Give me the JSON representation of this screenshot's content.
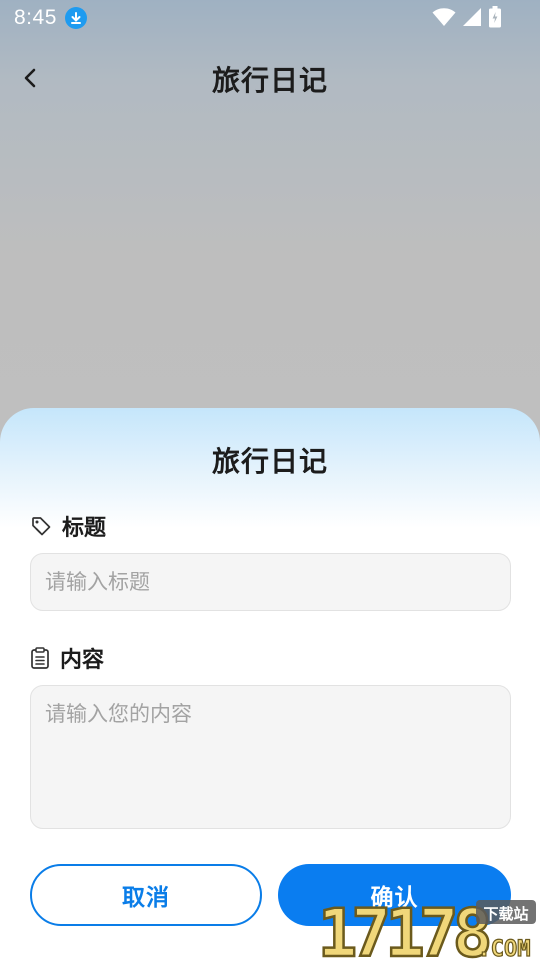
{
  "status_bar": {
    "time": "8:45"
  },
  "header": {
    "title": "旅行日记"
  },
  "sheet": {
    "title": "旅行日记",
    "title_field": {
      "label": "标题",
      "placeholder": "请输入标题",
      "value": ""
    },
    "content_field": {
      "label": "内容",
      "placeholder": "请输入您的内容",
      "value": ""
    },
    "cancel_label": "取消",
    "confirm_label": "确认"
  },
  "watermark": {
    "number": "17178",
    "domain": ".COM",
    "badge": "下载站"
  },
  "colors": {
    "accent": "#0a7df0",
    "download_badge": "#1e9bf0",
    "sheet_top": "#c5e6fb"
  }
}
